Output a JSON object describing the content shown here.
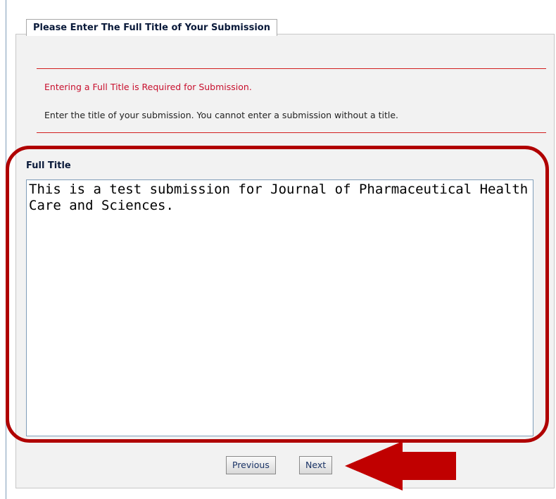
{
  "tab": {
    "label": "Please Enter The Full Title of Your Submission"
  },
  "messages": {
    "required": "Entering a Full Title is Required for Submission.",
    "help": "Enter the title of your submission. You cannot enter a submission without a title."
  },
  "field": {
    "label": "Full Title",
    "value": "This is a test submission for Journal of Pharmaceutical Health Care and Sciences."
  },
  "buttons": {
    "previous": "Previous",
    "next": "Next"
  },
  "colors": {
    "error": "#c8102e",
    "highlight": "#b00000",
    "tab_text": "#0a1a3a"
  }
}
